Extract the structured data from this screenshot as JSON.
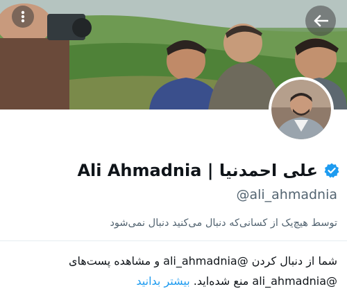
{
  "header": {
    "back_icon": "arrow-left-icon",
    "menu_icon": "more-vertical-icon"
  },
  "profile": {
    "display_name": "علی احمدنیا | Ali Ahmadnia",
    "handle": "@ali_ahmadnia",
    "verified": true,
    "verified_color": "#1d9bf0",
    "followed_by": "توسط هیچ‌یک از کسانی‌که دنبال می‌کنید دنبال نمی‌شود"
  },
  "notice": {
    "line1": "شما از دنبال کردن @ali_ahmadnia و مشاهده پست‌های",
    "line2": "@ali_ahmadnia منع شده‌اید.",
    "learn_more": "بیشتر بدانید",
    "link_color": "#1d9bf0"
  }
}
